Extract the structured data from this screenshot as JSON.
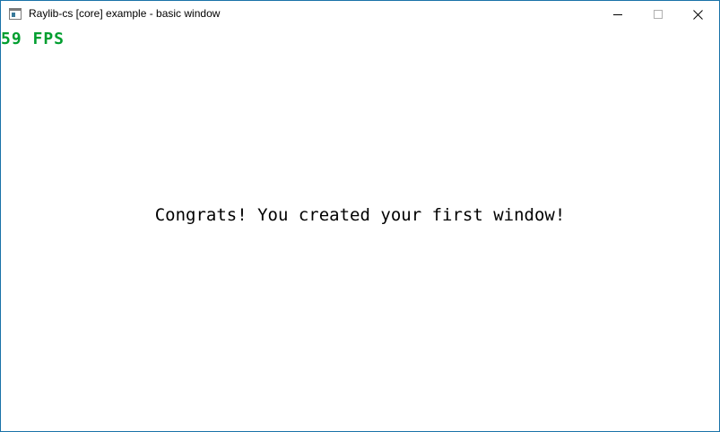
{
  "window": {
    "title": "Raylib-cs [core] example - basic window",
    "icon": "app-window-icon",
    "controls": {
      "minimize_icon": "minimize-icon",
      "maximize_icon": "maximize-icon",
      "close_icon": "close-icon"
    },
    "border_color": "#1a73a8"
  },
  "canvas": {
    "fps_text": "59 FPS",
    "fps_color": "#009e2f",
    "message": "Congrats! You created your first window!",
    "background": "#ffffff"
  }
}
